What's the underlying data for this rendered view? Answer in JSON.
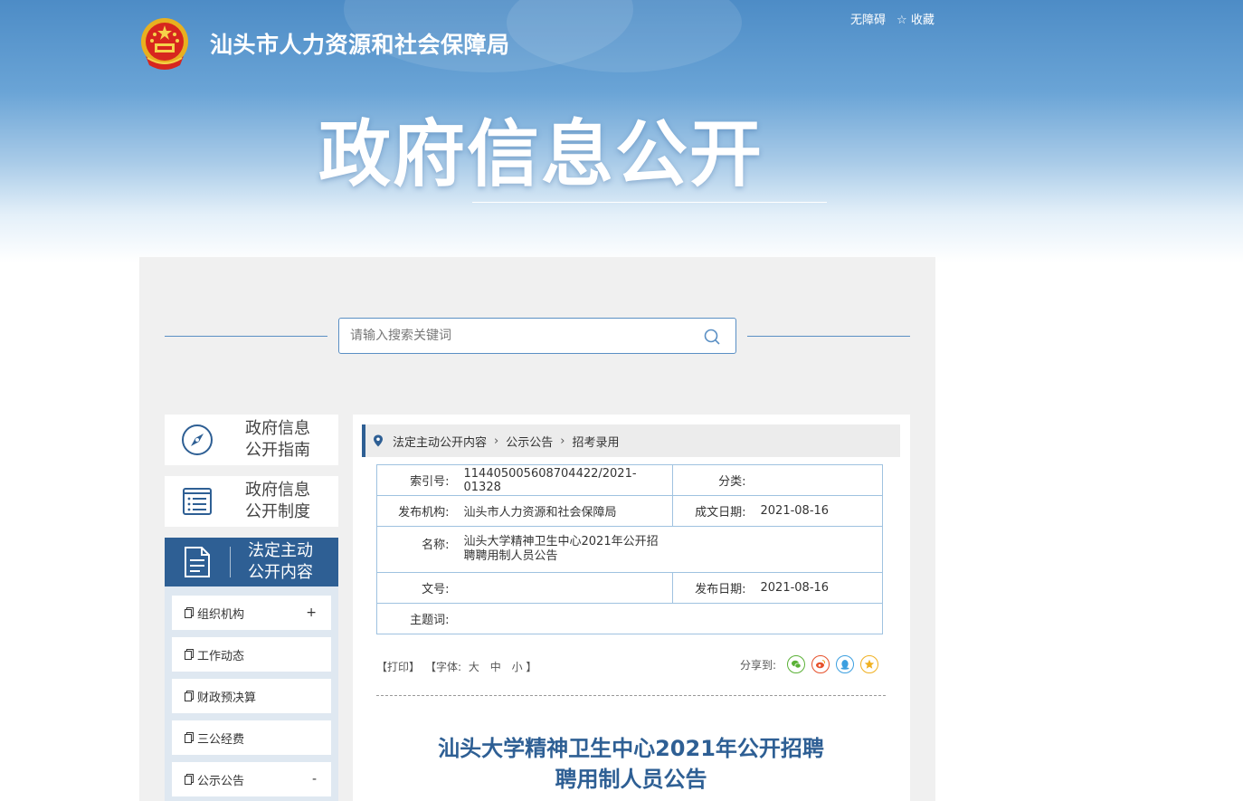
{
  "header": {
    "agency_name": "汕头市人力资源和社会保障局",
    "accessibility_label": "无障碍",
    "favorite_label": "收藏",
    "banner_title": "政府信息公开"
  },
  "search": {
    "placeholder": "请输入搜索关键词"
  },
  "sidebar": {
    "cards": [
      {
        "line1": "政府信息",
        "line2": "公开指南"
      },
      {
        "line1": "政府信息",
        "line2": "公开制度"
      },
      {
        "line1": "法定主动",
        "line2": "公开内容"
      }
    ],
    "sub_items": [
      {
        "label": "组织机构",
        "toggle": "+"
      },
      {
        "label": "工作动态",
        "toggle": ""
      },
      {
        "label": "财政预决算",
        "toggle": ""
      },
      {
        "label": "三公经费",
        "toggle": ""
      },
      {
        "label": "公示公告",
        "toggle": "-"
      }
    ]
  },
  "breadcrumb": [
    "法定主动公开内容",
    "公示公告",
    "招考录用"
  ],
  "meta": {
    "index_label": "索引号:",
    "index_value": "114405005608704422/2021-01328",
    "category_label": "分类:",
    "category_value": "",
    "publisher_label": "发布机构:",
    "publisher_value": "汕头市人力资源和社会保障局",
    "written_date_label": "成文日期:",
    "written_date_value": "2021-08-16",
    "name_label": "名称:",
    "name_value": "汕头大学精神卫生中心2021年公开招聘聘用制人员公告",
    "docnum_label": "文号:",
    "docnum_value": "",
    "publish_date_label": "发布日期:",
    "publish_date_value": "2021-08-16",
    "subject_label": "主题词:",
    "subject_value": ""
  },
  "tools": {
    "print": "【打印】",
    "font_label": "【字体:",
    "font_large": "大",
    "font_medium": "中",
    "font_small": "小",
    "font_close": "】",
    "share_label": "分享到:"
  },
  "article": {
    "title_line1": "汕头大学精神卫生中心2021年公开招聘",
    "title_line2": "聘用制人员公告"
  },
  "colors": {
    "primary": "#2e5f94",
    "accent_line": "#5a8fc4",
    "table_border": "#9fc2e0",
    "wechat": "#5ab136",
    "weibo": "#e6512b",
    "qq": "#3b9fe0",
    "qzone": "#f0b020"
  }
}
